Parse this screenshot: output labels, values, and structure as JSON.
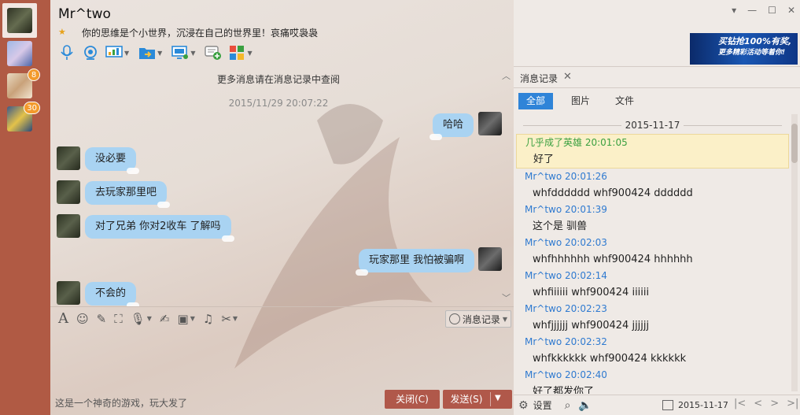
{
  "window": {
    "contact_name": "Mr^two",
    "signature": "你的思维是个小世界，沉浸在自己的世界里！哀痛哎袅袅",
    "controls": [
      "▾",
      "—",
      "☐",
      "✕"
    ]
  },
  "contacts": [
    {
      "name": "contact-1",
      "badge": ""
    },
    {
      "name": "contact-2",
      "badge": ""
    },
    {
      "name": "contact-3",
      "badge": "8"
    },
    {
      "name": "contact-4",
      "badge": "30"
    }
  ],
  "toolbar_icons": [
    "mic-icon",
    "webcam-icon",
    "screen-share-icon",
    "file-transfer-icon",
    "remote-desktop-icon",
    "add-chat-icon",
    "apps-icon"
  ],
  "chat": {
    "more_hint": "更多消息请在消息记录中查阅",
    "timestamp": "2015/11/29 20:07:22",
    "messages": [
      {
        "from": "me",
        "text": "哈哈"
      },
      {
        "from": "peer",
        "text": "没必要"
      },
      {
        "from": "peer",
        "text": "去玩家那里吧"
      },
      {
        "from": "peer",
        "text": "对了兄弟 你对2收车 了解吗"
      },
      {
        "from": "me",
        "text": "玩家那里 我怕被骗啊"
      },
      {
        "from": "peer",
        "text": "不会的"
      }
    ]
  },
  "input": {
    "history_button": "消息记录",
    "draft_text": "这是一个神奇的游戏，玩大发了",
    "close_button": "关闭(C)",
    "send_button": "发送(S)"
  },
  "ad": {
    "line1": "买钻抢100%有奖,",
    "line2": "更多精彩活动等着你!"
  },
  "history": {
    "tab_label": "消息记录",
    "filters": [
      "全部",
      "图片",
      "文件"
    ],
    "active_filter": "全部",
    "date": "2015-11-17",
    "entries": [
      {
        "head": "几乎成了英雄 20:01:05",
        "body": "好了",
        "highlight": true
      },
      {
        "head": "Mr^two 20:01:26",
        "body": "whfdddddd  whf900424  dddddd",
        "highlight": false
      },
      {
        "head": "Mr^two 20:01:39",
        "body": "这个是 驯兽",
        "highlight": false
      },
      {
        "head": "Mr^two 20:02:03",
        "body": "whfhhhhhh  whf900424  hhhhhh",
        "highlight": false
      },
      {
        "head": "Mr^two 20:02:14",
        "body": "whfiiiiii  whf900424  iiiiii",
        "highlight": false
      },
      {
        "head": "Mr^two 20:02:23",
        "body": "whfjjjjjj  whf900424 jjjjjj",
        "highlight": false
      },
      {
        "head": "Mr^two 20:02:32",
        "body": "whfkkkkkk  whf900424  kkkkkk",
        "highlight": false
      },
      {
        "head": "Mr^two 20:02:40",
        "body": "好了都发你了",
        "highlight": false
      }
    ],
    "settings_label": "设置",
    "footer_date": "2015-11-17"
  },
  "colors": {
    "sidebar": "#b05a44",
    "bubble": "#a9d3f2",
    "button": "#b0584a",
    "accent": "#2f84d8"
  }
}
